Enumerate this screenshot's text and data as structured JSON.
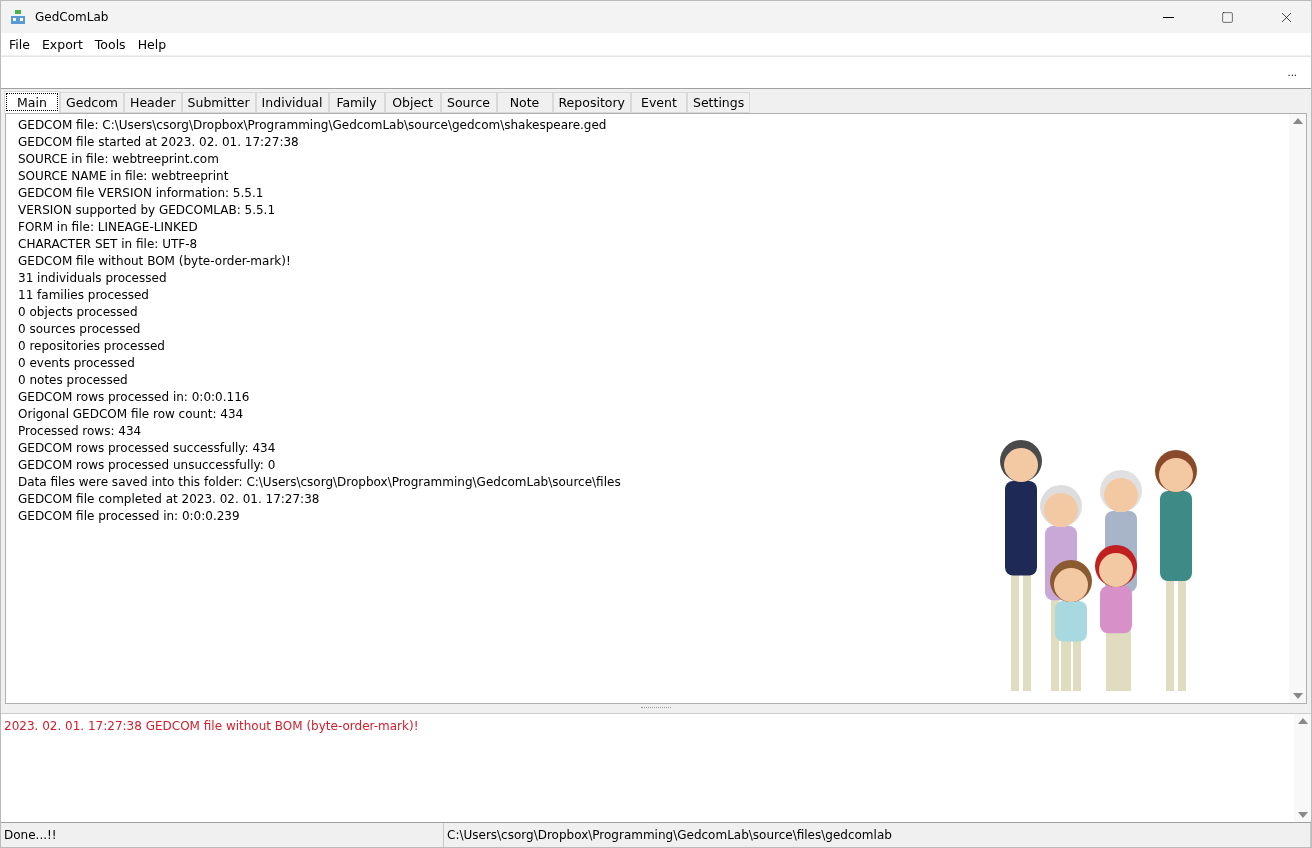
{
  "window": {
    "title": "GedComLab"
  },
  "menu": [
    "File",
    "Export",
    "Tools",
    "Help"
  ],
  "toolbar": {
    "button": "..."
  },
  "tabs": [
    {
      "label": "Main",
      "selected": true
    },
    {
      "label": "Gedcom",
      "selected": false
    },
    {
      "label": "Header",
      "selected": false
    },
    {
      "label": "Submitter",
      "selected": false
    },
    {
      "label": "Individual",
      "selected": false
    },
    {
      "label": "Family",
      "selected": false
    },
    {
      "label": "Object",
      "selected": false
    },
    {
      "label": "Source",
      "selected": false
    },
    {
      "label": "Note",
      "selected": false
    },
    {
      "label": "Repository",
      "selected": false
    },
    {
      "label": "Event",
      "selected": false
    },
    {
      "label": "Settings",
      "selected": false
    }
  ],
  "output_lines": [
    "GEDCOM file: C:\\Users\\csorg\\Dropbox\\Programming\\GedcomLab\\source\\gedcom\\shakespeare.ged",
    "GEDCOM file started at 2023. 02. 01. 17:27:38",
    "SOURCE in file: webtreeprint.com",
    "SOURCE NAME in file: webtreeprint",
    "GEDCOM file VERSION information: 5.5.1",
    "VERSION supported by GEDCOMLAB: 5.5.1",
    "FORM in file: LINEAGE-LINKED",
    "CHARACTER SET in file: UTF-8",
    "GEDCOM file without BOM (byte-order-mark)!",
    "31 individuals processed",
    "11 families processed",
    "0 objects processed",
    "0 sources processed",
    "0 repositories processed",
    "0 events processed",
    "0 notes processed",
    "GEDCOM rows processed in: 0:0:0.116",
    "Origonal GEDCOM file row count: 434",
    "Processed rows: 434",
    "GEDCOM rows processed successfully: 434",
    "GEDCOM rows processed unsuccessfully: 0",
    "Data files were saved into this folder: C:\\Users\\csorg\\Dropbox\\Programming\\GedcomLab\\source\\files",
    "GEDCOM file completed at 2023. 02. 01. 17:27:38",
    "GEDCOM file processed in: 0:0:0.239"
  ],
  "log": [
    {
      "text": "2023. 02. 01. 17:27:38 GEDCOM file without BOM (byte-order-mark)!",
      "kind": "error"
    }
  ],
  "status_bar": [
    "Done...!!",
    "C:\\Users\\csorg\\Dropbox\\Programming\\GedcomLab\\source\\files\\gedcomlab"
  ]
}
